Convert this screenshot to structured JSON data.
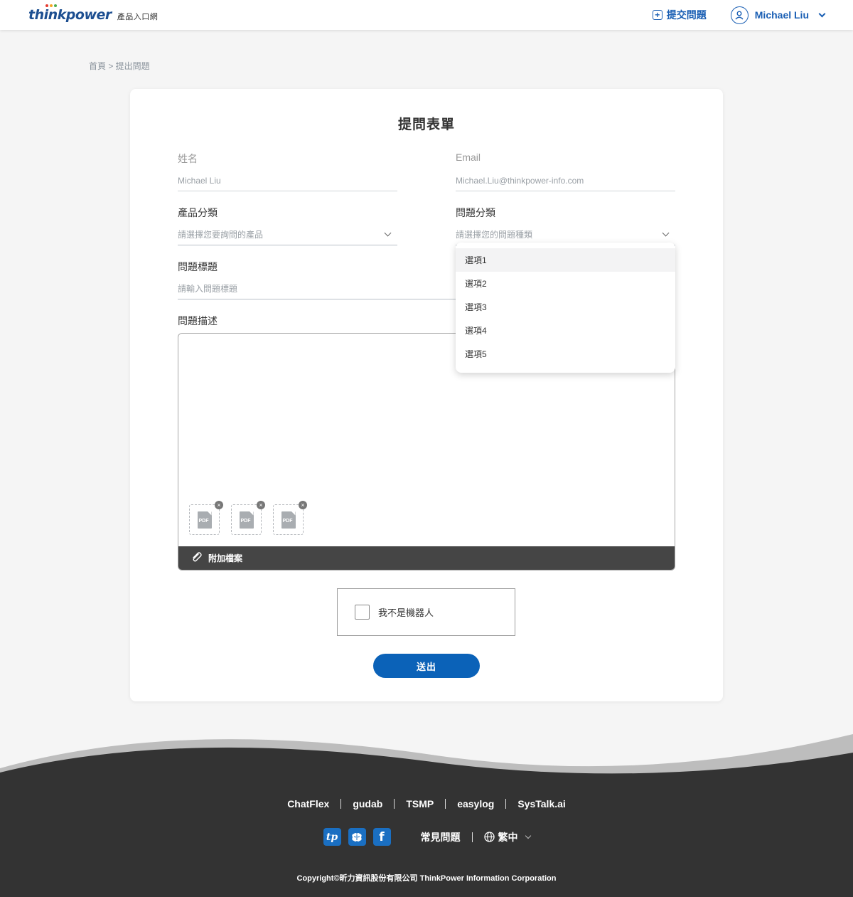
{
  "header": {
    "brand_think": "think",
    "brand_power": "power",
    "brand_sub": "產品入口網",
    "submit_label": "提交問題",
    "user_name": "Michael Liu"
  },
  "breadcrumb": "首頁 > 提出問題",
  "form": {
    "title": "提問表單",
    "name_label": "姓名",
    "name_value": "Michael Liu",
    "email_label": "Email",
    "email_value": "Michael.Liu@thinkpower-info.com",
    "product_label": "產品分類",
    "product_placeholder": "請選擇您要詢問的產品",
    "category_label": "問題分類",
    "category_placeholder": "請選擇您的問題種類",
    "title_label": "問題標題",
    "title_placeholder": "請輸入問題標題",
    "desc_label": "問題描述",
    "attachments": [
      "PDF",
      "PDF",
      "PDF"
    ],
    "attach_label": "附加檔案",
    "captcha_label": "我不是機器人",
    "submit_label": "送出"
  },
  "dropdown": {
    "options": [
      "選項1",
      "選項2",
      "選項3",
      "選項4",
      "選項5"
    ],
    "highlighted": "選項1"
  },
  "footer": {
    "links": [
      "ChatFlex",
      "gudab",
      "TSMP",
      "easylog",
      "SysTalk.ai"
    ],
    "social": [
      "tp",
      "brain",
      "f"
    ],
    "faq": "常見問題",
    "language": "繁中",
    "copyright": "Copyright©昕力資訊股份有限公司 ThinkPower Information Corporation"
  },
  "colors": {
    "primary": "#0b62b8",
    "footer_bg": "#333333",
    "wave_light": "#bdbdbd"
  }
}
